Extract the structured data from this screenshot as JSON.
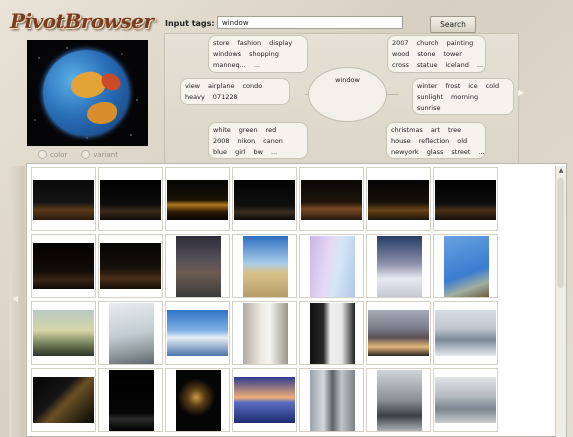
{
  "app": {
    "logo": "PivotBrowser"
  },
  "preview": {
    "radio_options": [
      "color",
      "variant"
    ]
  },
  "search": {
    "label": "Input tags:",
    "value": "window",
    "button": "Search"
  },
  "tag_cloud": {
    "center": "window",
    "groups": [
      {
        "id": "top-left",
        "rows": [
          [
            "store",
            "fashion",
            "display"
          ],
          [
            "windows",
            "shopping"
          ],
          [
            "manneq...",
            "..."
          ]
        ]
      },
      {
        "id": "top-right",
        "rows": [
          [
            "2007",
            "church",
            "painting"
          ],
          [
            "wood",
            "stone",
            "tower"
          ],
          [
            "cross",
            "statue",
            "iceland",
            "..."
          ]
        ]
      },
      {
        "id": "mid-left",
        "rows": [
          [
            "view",
            "airplane",
            "condo"
          ],
          [
            "heavy",
            "071228"
          ]
        ]
      },
      {
        "id": "mid-right",
        "rows": [
          [
            "winter",
            "frost",
            "ice",
            "cold"
          ],
          [
            "sunlight",
            "morning"
          ],
          [
            "sunrise"
          ]
        ]
      },
      {
        "id": "bottom-left",
        "rows": [
          [
            "white",
            "green",
            "red"
          ],
          [
            "2008",
            "nikon",
            "canon"
          ],
          [
            "blue",
            "girl",
            "bw",
            "..."
          ]
        ]
      },
      {
        "id": "bottom-right",
        "rows": [
          [
            "christmas",
            "art",
            "tree"
          ],
          [
            "house",
            "reflection",
            "old"
          ],
          [
            "newyork",
            "glass",
            "street",
            "..."
          ]
        ]
      }
    ]
  },
  "icons": {
    "cloud_next": "right-arrow-icon",
    "grid_prev": "left-arrow-icon"
  },
  "colors": {
    "accent": "#7a3c1f",
    "panel": "#dcd5c9"
  }
}
